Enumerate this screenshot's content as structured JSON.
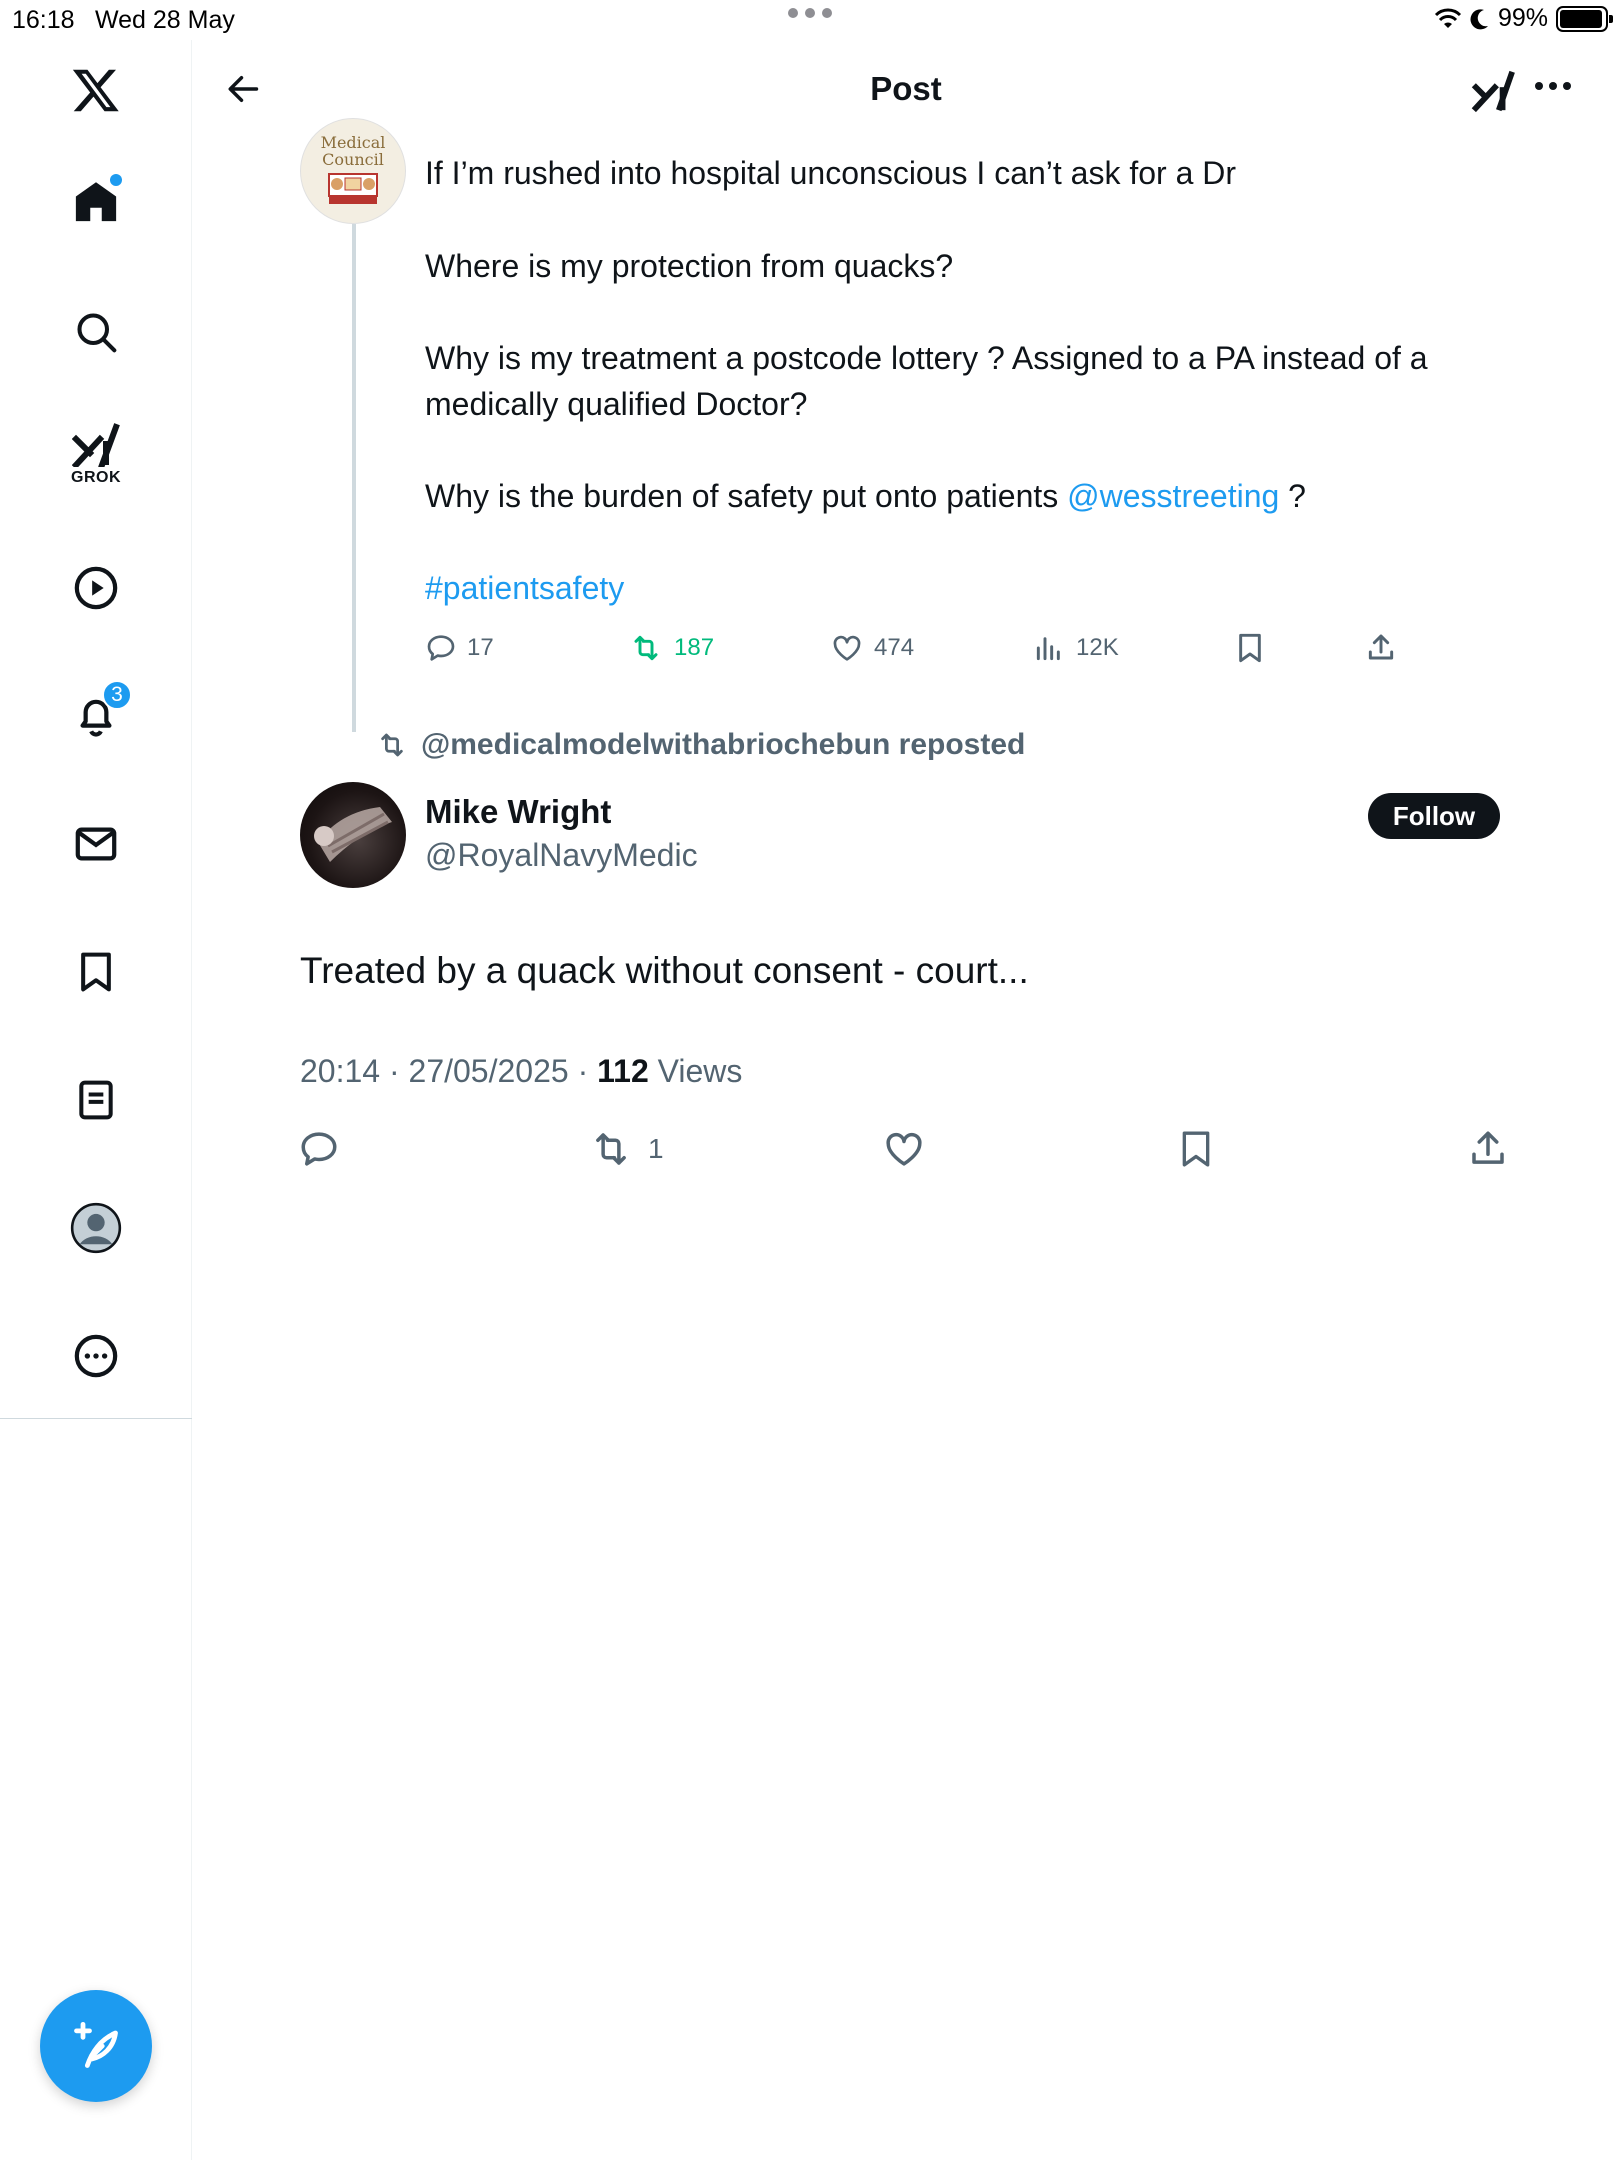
{
  "status_bar": {
    "time": "16:18",
    "date": "Wed 28 May",
    "battery": "99%",
    "battery_level": 0.99
  },
  "sidebar": {
    "items": [
      {
        "name": "x-logo",
        "icon": "x-logo-icon"
      },
      {
        "name": "home",
        "icon": "home-icon",
        "has_dot": true
      },
      {
        "name": "explore",
        "icon": "search-icon"
      },
      {
        "name": "grok",
        "icon": "grok-icon",
        "label": "GROK"
      },
      {
        "name": "videos",
        "icon": "play-icon"
      },
      {
        "name": "notifications",
        "icon": "bell-icon",
        "badge": "3"
      },
      {
        "name": "messages",
        "icon": "mail-icon"
      },
      {
        "name": "bookmarks",
        "icon": "bookmark-icon"
      },
      {
        "name": "lists",
        "icon": "list-icon"
      },
      {
        "name": "profile",
        "icon": "profile-icon"
      },
      {
        "name": "more",
        "icon": "more-circle-icon"
      }
    ],
    "compose_icon": "compose-feather-icon"
  },
  "header": {
    "title": "Post"
  },
  "parent_post": {
    "lines": [
      "If I’m rushed into hospital unconscious I can’t ask for a Dr",
      "Where is my protection from quacks?",
      "Why is my treatment a postcode lottery ? Assigned to a PA instead of a medically qualified Doctor?",
      "Why is the burden of safety put onto patients"
    ],
    "mention": "@wesstreeting",
    "mention_suffix": " ?",
    "hashtag": "#patientsafety",
    "stats": {
      "replies": "17",
      "reposts": "187",
      "likes": "474",
      "views": "12K"
    },
    "avatar_text": [
      "Medical",
      "Council"
    ]
  },
  "repost_banner": {
    "text": "@medicalmodelwithabriochebun reposted"
  },
  "main_post": {
    "author_name": "Mike Wright",
    "author_handle": "@RoyalNavyMedic",
    "follow_label": "Follow",
    "text": "Treated by a quack without consent - court...",
    "time": "20:14 · 27/05/2025 · ",
    "views_count": "112",
    "views_label": " Views",
    "reposts": "1"
  },
  "colors": {
    "accent": "#1d9bf0",
    "repost_green": "#00ba7c",
    "text": "#0f1419",
    "secondary": "#536471"
  }
}
